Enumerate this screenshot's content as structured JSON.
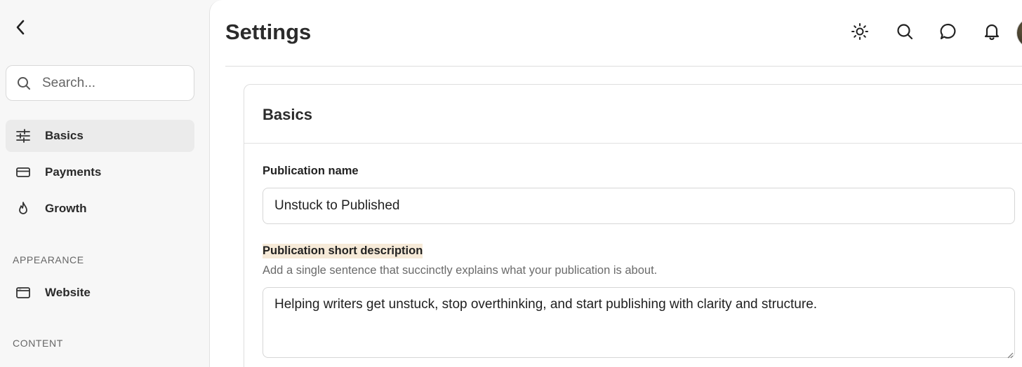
{
  "sidebar": {
    "search": {
      "placeholder": "Search...",
      "value": ""
    },
    "items": [
      {
        "label": "Basics",
        "icon": "sliders-icon",
        "active": true
      },
      {
        "label": "Payments",
        "icon": "credit-card-icon",
        "active": false
      },
      {
        "label": "Growth",
        "icon": "flame-icon",
        "active": false
      }
    ],
    "sections": [
      {
        "label": "APPEARANCE"
      },
      {
        "label": "CONTENT"
      }
    ],
    "appearance_items": [
      {
        "label": "Website",
        "icon": "browser-window-icon"
      }
    ]
  },
  "header": {
    "title": "Settings",
    "icons": [
      "sun-icon",
      "search-icon",
      "chat-bubble-icon",
      "bell-icon",
      "avatar"
    ]
  },
  "card": {
    "title": "Basics",
    "fields": {
      "name": {
        "label": "Publication name",
        "value": "Unstuck to Published"
      },
      "description": {
        "label": "Publication short description",
        "help": "Add a single sentence that succinctly explains what your publication is about.",
        "value": "Helping writers get unstuck, stop overthinking, and start publishing with clarity and structure."
      }
    }
  },
  "colors": {
    "active_nav_bg": "#ebebeb",
    "label_highlight": "#f6ead8",
    "text_primary": "#2b2b2b",
    "text_secondary": "#6a6a6a"
  }
}
